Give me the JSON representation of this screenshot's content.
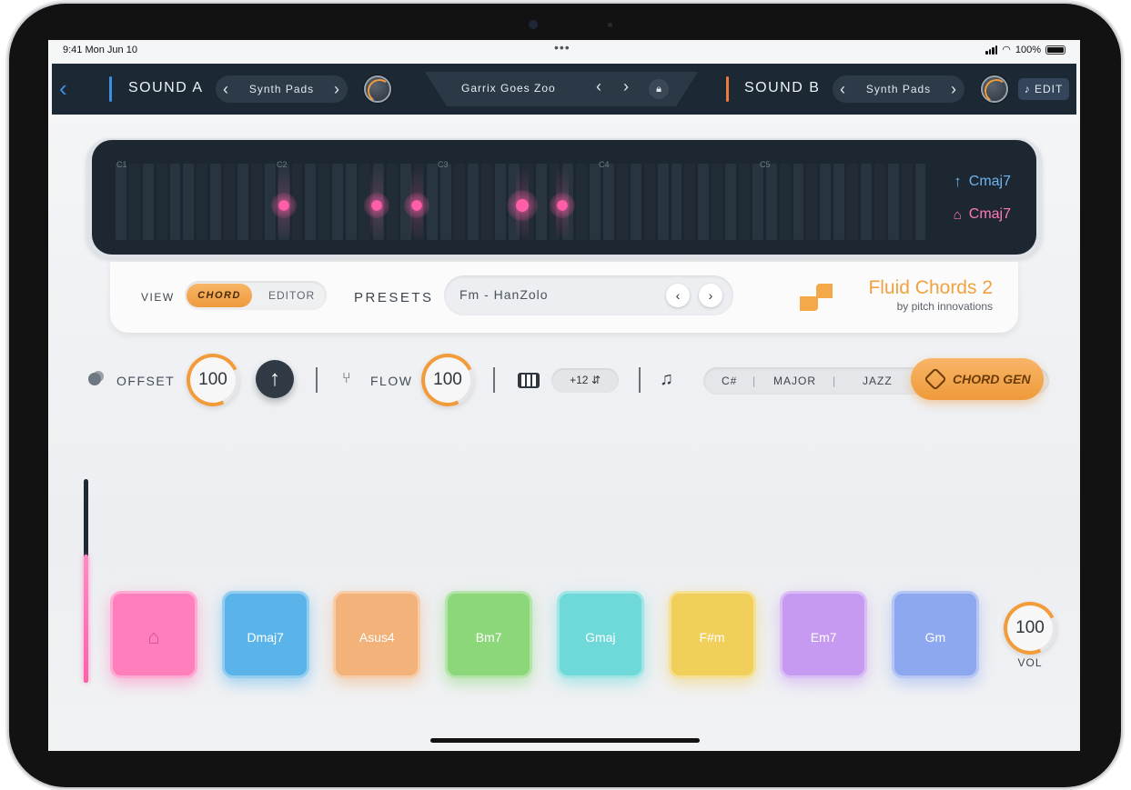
{
  "status": {
    "time": "9:41  Mon Jun 10",
    "dots": "•••",
    "battery": "100%",
    "battery_fraction": 1.0
  },
  "topbar": {
    "sound_a": {
      "label": "SOUND A",
      "category": "Synth Pads",
      "accent": "#3d8fe0"
    },
    "preset": {
      "name": "Garrix Goes Zoo"
    },
    "sound_b": {
      "label": "SOUND B",
      "category": "Synth Pads",
      "accent": "#f07a3a"
    },
    "edit_label": "EDIT"
  },
  "keyboard": {
    "octaves": [
      "C1",
      "C2",
      "C3",
      "C4",
      "C5"
    ],
    "active_notes_fraction": [
      0.208,
      0.322,
      0.372,
      0.502,
      0.552
    ],
    "chord_top": "Cmaj7",
    "chord_root": "Cmaj7"
  },
  "view": {
    "label": "VIEW",
    "options": [
      "CHORD",
      "EDITOR"
    ],
    "selected": "CHORD",
    "presets_label": "PRESETS",
    "preset_value": "Fm - HanZolo",
    "brand_name": "Fluid Chords 2",
    "brand_sub": "by pitch innovations"
  },
  "controls": {
    "offset_label": "OFFSET",
    "offset_value": "100",
    "flow_label": "FLOW",
    "flow_value": "100",
    "octave_shift": "+12",
    "gen_key": "C#",
    "gen_scale": "MAJOR",
    "gen_style": "JAZZ",
    "chord_gen_label": "CHORD GEN"
  },
  "slider": {
    "level_fraction": 0.63,
    "color": "#ff5fa8"
  },
  "pads": [
    {
      "label": "",
      "icon": "home-icon",
      "color": "#ff7fbd"
    },
    {
      "label": "Dmaj7",
      "color": "#5ab4ea"
    },
    {
      "label": "Asus4",
      "color": "#f2b27a"
    },
    {
      "label": "Bm7",
      "color": "#8bd77a"
    },
    {
      "label": "Gmaj",
      "color": "#6fd9d9"
    },
    {
      "label": "F#m",
      "color": "#f0cf5a"
    },
    {
      "label": "Em7",
      "color": "#c69af0"
    },
    {
      "label": "Gm",
      "color": "#8ea8f0"
    }
  ],
  "volume": {
    "value": "100",
    "label": "VOL"
  }
}
